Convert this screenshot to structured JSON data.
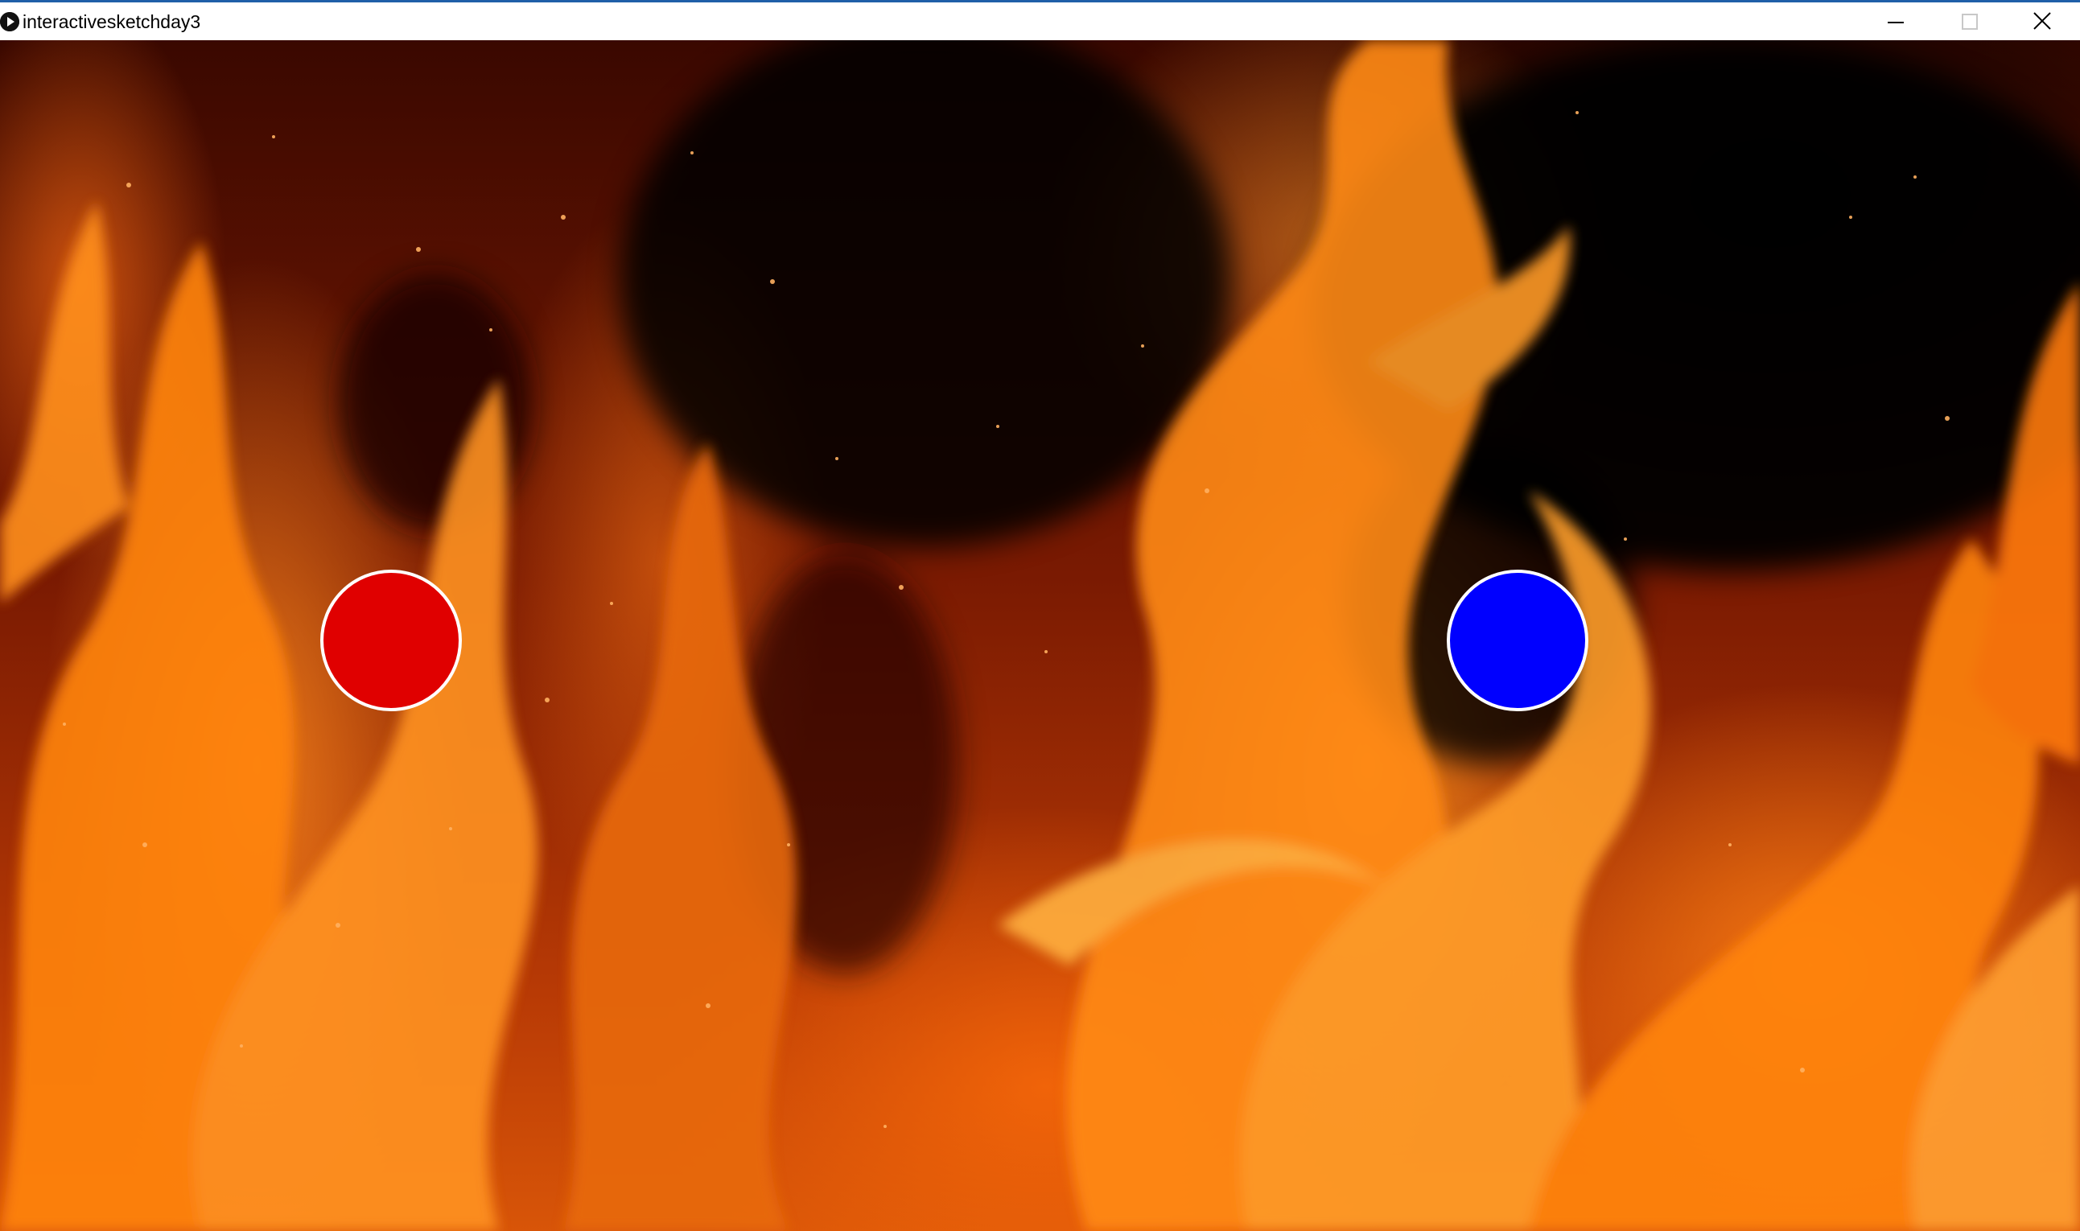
{
  "window": {
    "title": "interactivesketchday3",
    "app_icon": "processing-play-icon",
    "controls": {
      "minimize_icon": "minimize-icon",
      "maximize_icon": "maximize-icon",
      "close_icon": "close-icon"
    }
  },
  "sketch": {
    "background": "fire flames photo",
    "circles": [
      {
        "name": "red-circle",
        "fill": "#e00000",
        "stroke": "#ffffff"
      },
      {
        "name": "blue-circle",
        "fill": "#0000ff",
        "stroke": "#ffffff"
      }
    ]
  }
}
